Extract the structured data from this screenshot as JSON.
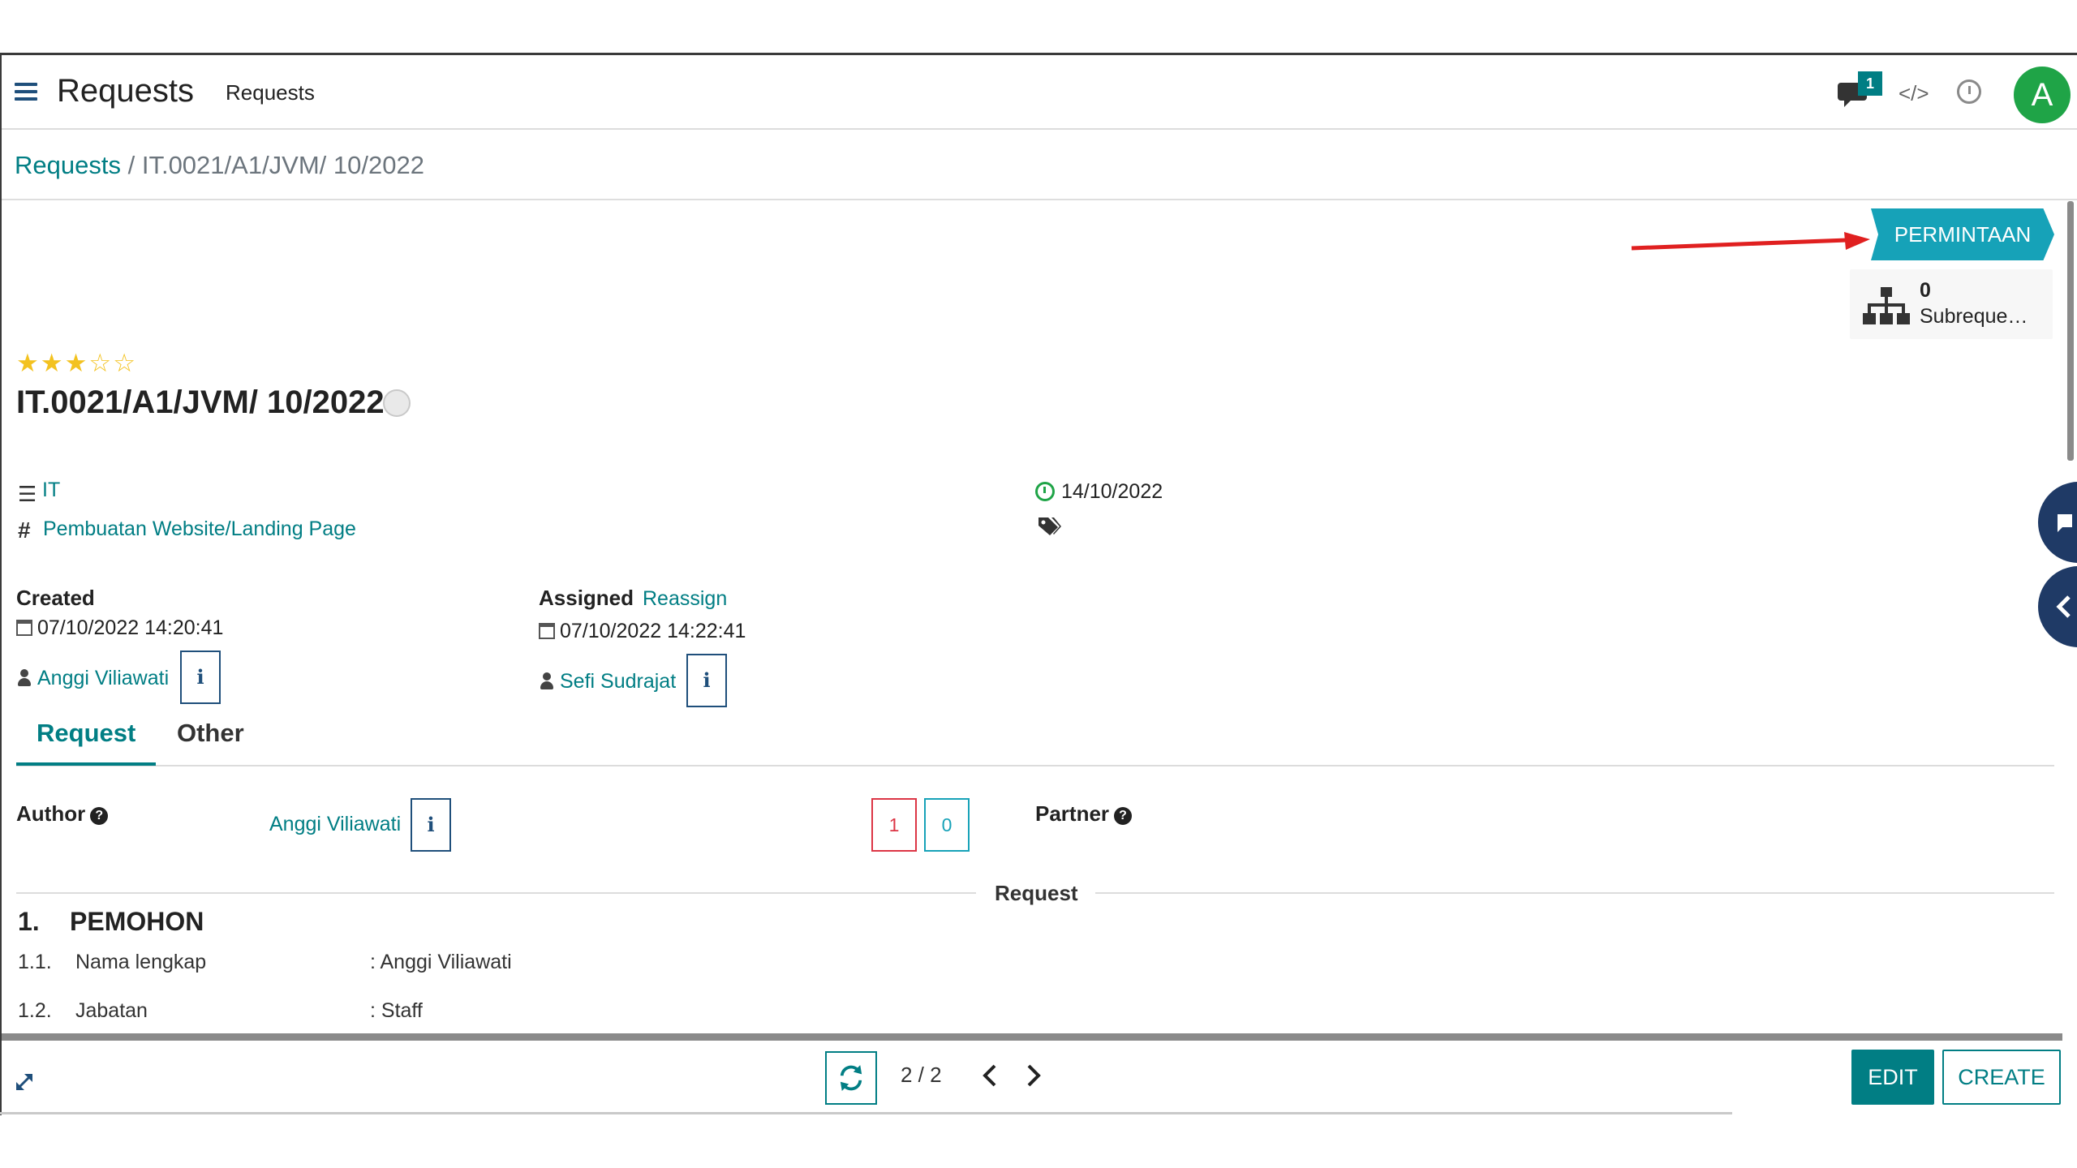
{
  "navbar": {
    "app_title": "Requests",
    "menu_item": "Requests",
    "chat_badge": "1",
    "debug_label": "</>",
    "avatar_letter": "A"
  },
  "breadcrumb": {
    "parent": "Requests",
    "separator": "/",
    "current": "IT.0021/A1/JVM/ 10/2022"
  },
  "status": {
    "label": "PERMINTAAN"
  },
  "smart_button": {
    "count": "0",
    "label": "Subreque…"
  },
  "record": {
    "priority_stars": 3,
    "priority_max": 5,
    "title": "IT.0021/A1/JVM/ 10/2022",
    "category": "IT",
    "type": "Pembuatan Website/Landing Page",
    "deadline": "14/10/2022"
  },
  "created": {
    "label": "Created",
    "datetime": "07/10/2022 14:20:41",
    "user": "Anggi Viliawati",
    "info": "i"
  },
  "assigned": {
    "label": "Assigned",
    "reassign": "Reassign",
    "datetime": "07/10/2022 14:22:41",
    "user": "Sefi Sudrajat",
    "info": "i"
  },
  "tabs": [
    {
      "label": "Request",
      "active": true
    },
    {
      "label": "Other",
      "active": false
    }
  ],
  "author": {
    "label": "Author",
    "help": "?",
    "value": "Anggi Viliawati",
    "info": "i",
    "count_red": "1",
    "count_teal": "0"
  },
  "partner": {
    "label": "Partner",
    "help": "?"
  },
  "section_separator": "Request",
  "document": {
    "heading_num": "1.",
    "heading": "PEMOHON",
    "rows": [
      {
        "num": "1.1.",
        "key": "Nama lengkap",
        "value": ": Anggi Viliawati"
      },
      {
        "num": "1.2.",
        "key": "Jabatan",
        "value": ": Staff"
      }
    ]
  },
  "pager": {
    "value": "2 / 2"
  },
  "buttons": {
    "edit": "EDIT",
    "create": "CREATE"
  },
  "colors": {
    "primary": "#017e84",
    "status_ribbon": "#16a2b8",
    "avatar": "#1fa447",
    "star": "#f3c21f",
    "annotation_arrow": "#e02020",
    "side_tab": "#1f3a66"
  }
}
